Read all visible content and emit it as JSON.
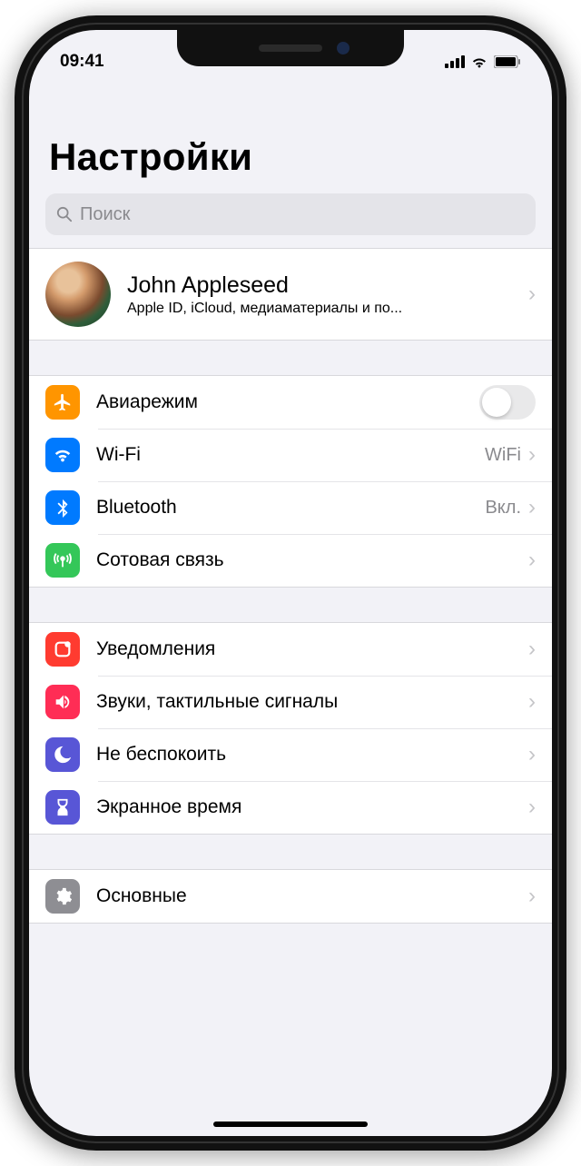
{
  "status": {
    "time": "09:41"
  },
  "title": "Настройки",
  "search": {
    "placeholder": "Поиск"
  },
  "profile": {
    "name": "John Appleseed",
    "sub": "Apple ID, iCloud, медиаматериалы и по..."
  },
  "groups": [
    {
      "items": [
        {
          "icon": "airplane-icon",
          "color": "bg-orange",
          "label": "Авиарежим",
          "control": "toggle",
          "toggle": false
        },
        {
          "icon": "wifi-icon",
          "color": "bg-blue",
          "label": "Wi-Fi",
          "value": "WiFi",
          "control": "nav"
        },
        {
          "icon": "bluetooth-icon",
          "color": "bg-blue2",
          "label": "Bluetooth",
          "value": "Вкл.",
          "control": "nav"
        },
        {
          "icon": "cellular-icon",
          "color": "bg-green",
          "label": "Сотовая связь",
          "control": "nav"
        }
      ]
    },
    {
      "items": [
        {
          "icon": "notifications-icon",
          "color": "bg-red",
          "label": "Уведомления",
          "control": "nav"
        },
        {
          "icon": "sounds-icon",
          "color": "bg-pink",
          "label": "Звуки, тактильные сигналы",
          "control": "nav"
        },
        {
          "icon": "dnd-icon",
          "color": "bg-purple",
          "label": "Не беспокоить",
          "control": "nav"
        },
        {
          "icon": "screentime-icon",
          "color": "bg-indigo",
          "label": "Экранное время",
          "control": "nav"
        }
      ]
    },
    {
      "items": [
        {
          "icon": "general-icon",
          "color": "bg-gray",
          "label": "Основные",
          "control": "nav"
        }
      ]
    }
  ]
}
